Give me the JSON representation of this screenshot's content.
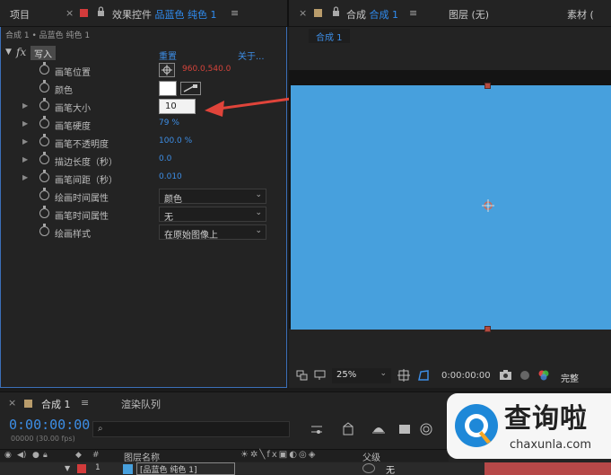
{
  "topbar": {
    "project_tab": "项目",
    "effects_tab_prefix": "效果控件",
    "effects_tab_layer": "品蓝色 纯色 1",
    "comp_tab_prefix": "合成",
    "comp_tab_name": "合成 1",
    "layer_tab": "图层 (无)",
    "footage_tab": "素材 ("
  },
  "fx": {
    "breadcrumb": "合成 1 • 品蓝色 纯色 1",
    "fx_symbol": "fx",
    "effect_name": "写入",
    "reset": "重置",
    "about": "关于...",
    "rows": [
      {
        "label": "画笔位置",
        "value": "960.0,540.0"
      },
      {
        "label": "颜色"
      },
      {
        "label": "画笔大小",
        "value": "10"
      },
      {
        "label": "画笔硬度",
        "value": "79 %"
      },
      {
        "label": "画笔不透明度",
        "value": "100.0 %"
      },
      {
        "label": "描边长度（秒）",
        "value": "0.0"
      },
      {
        "label": "画笔间距（秒）",
        "value": "0.010"
      },
      {
        "label": "绘画时间属性",
        "value": "颜色"
      },
      {
        "label": "画笔时间属性",
        "value": "无"
      },
      {
        "label": "绘画样式",
        "value": "在原始图像上"
      }
    ]
  },
  "comp": {
    "active_tab": "合成 1",
    "zoom": "25%",
    "timecode": "0:00:00:00",
    "resolution": "完整"
  },
  "timeline": {
    "comp_tab": "合成 1",
    "render_tab": "渲染队列",
    "timecode": "0:00:00:00",
    "frames": "00000 (30.00 fps)",
    "layer_name_header": "图层名称",
    "parent_header": "父级",
    "layer_index": "1",
    "layer_name": "[品蓝色 纯色 1]",
    "parent_value": "无"
  },
  "watermark": {
    "title": "查询啦",
    "url": "chaxunla.com"
  },
  "colors": {
    "accent": "#2f8cf0",
    "canvas": "#47a0dd",
    "arrow": "#e0443a"
  }
}
